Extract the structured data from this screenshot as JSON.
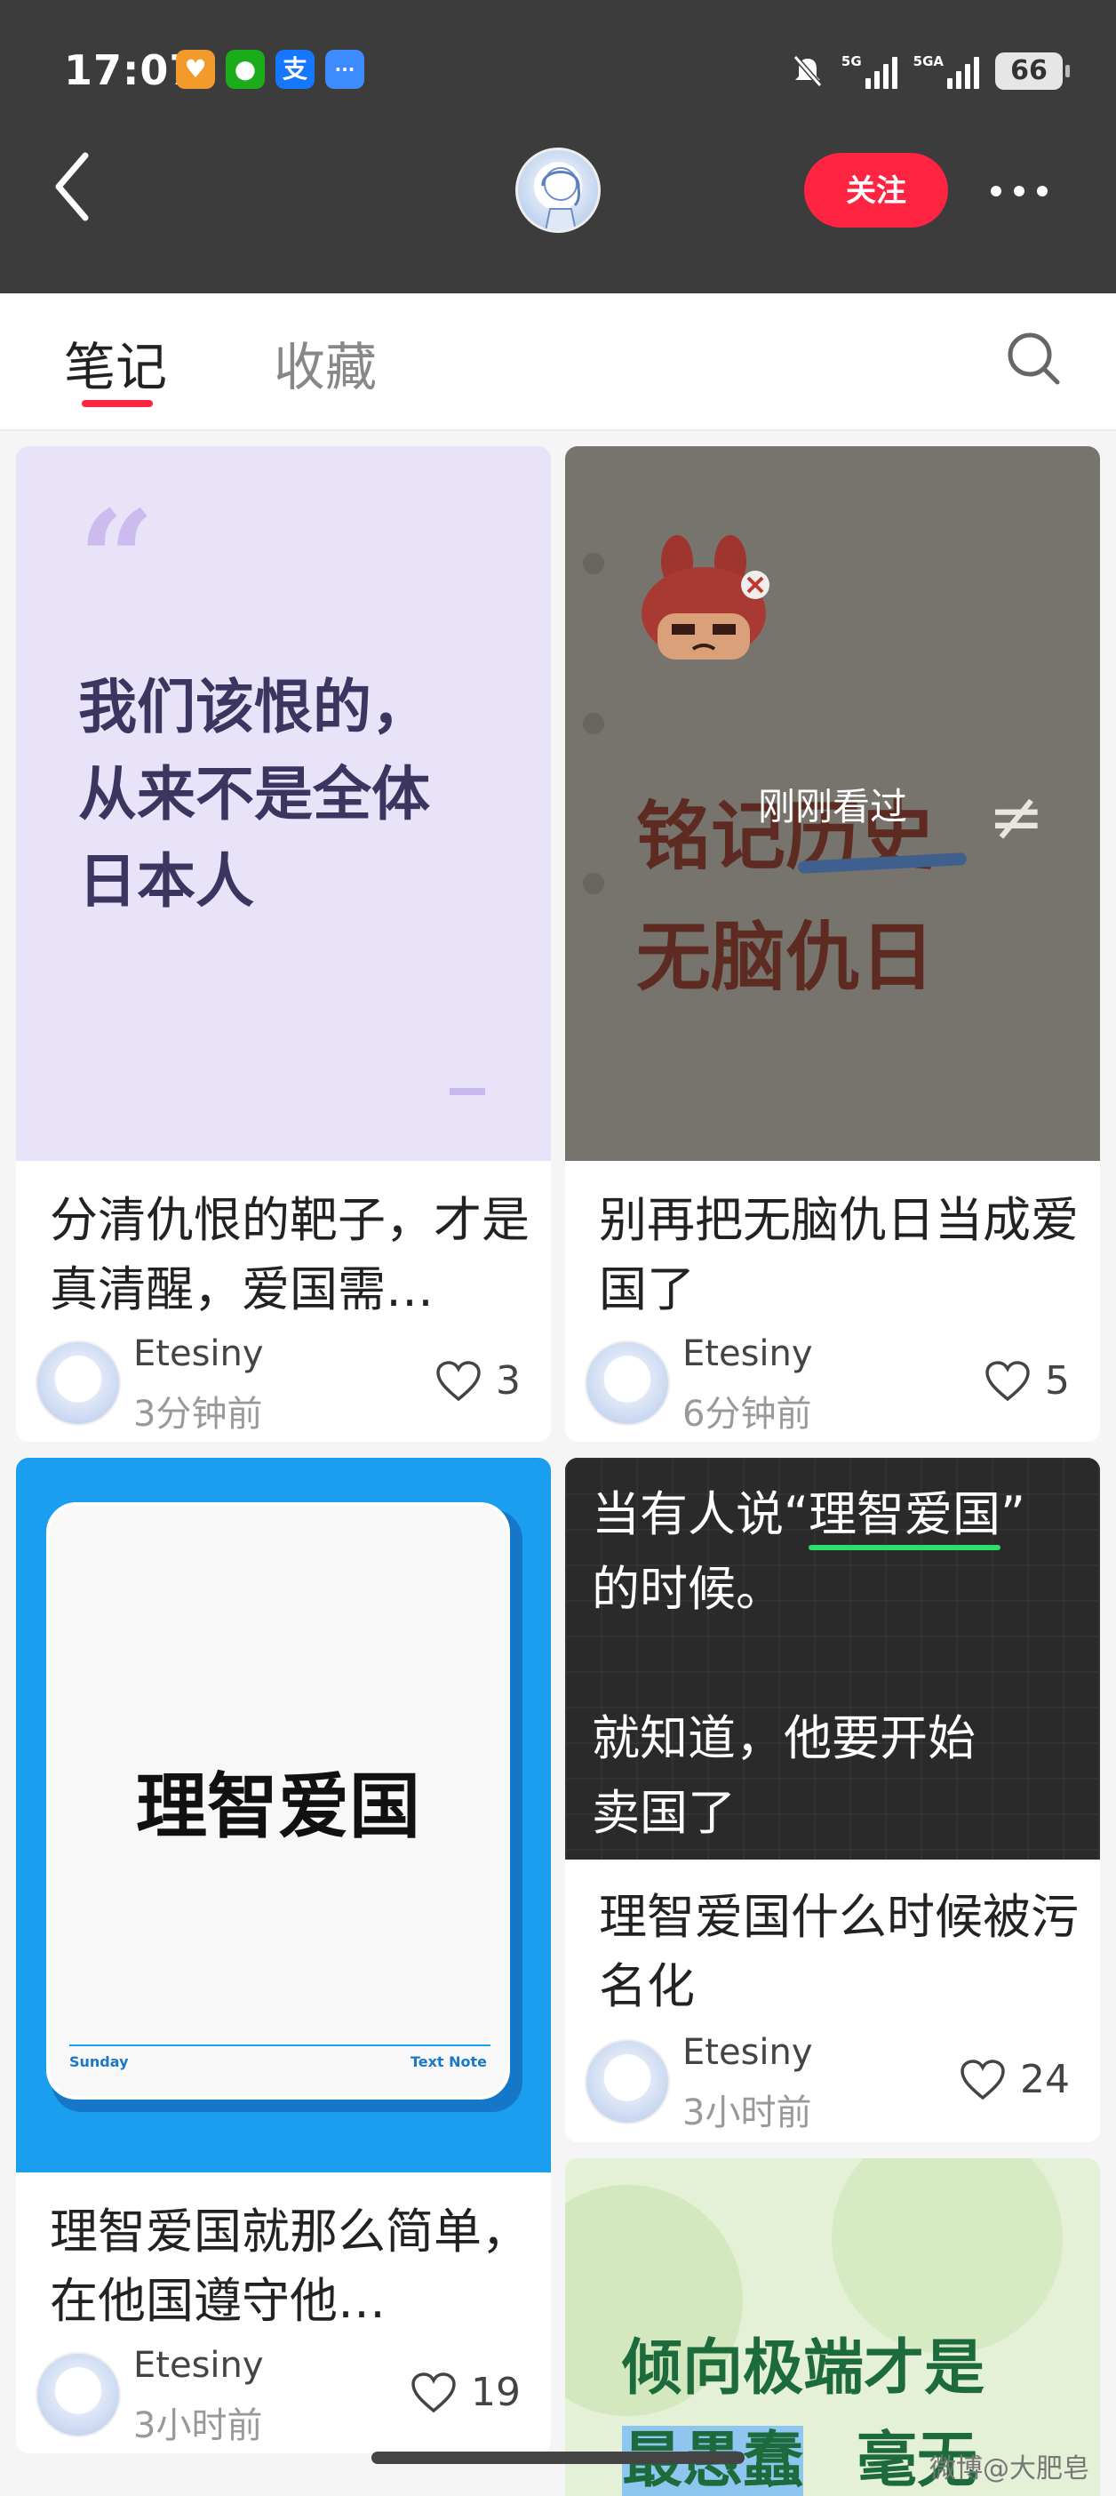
{
  "status_bar": {
    "time": "17:07",
    "network1": "5G",
    "network2": "5GA",
    "battery": "66"
  },
  "app_icons": [
    {
      "name": "heart-app-icon",
      "glyph": "♥",
      "color": "#f39a2c"
    },
    {
      "name": "wechat-icon",
      "glyph": "●",
      "color": "#1aad19"
    },
    {
      "name": "alipay-icon",
      "glyph": "支",
      "color": "#1677ff"
    },
    {
      "name": "message-icon",
      "glyph": "···",
      "color": "#3d8bff"
    }
  ],
  "header": {
    "follow_label": "关注"
  },
  "tabs": [
    {
      "label": "笔记",
      "active": true
    },
    {
      "label": "收藏",
      "active": false
    }
  ],
  "cards": [
    {
      "cover_text": [
        "我们该恨的，",
        "从来不是全体",
        "日本人"
      ],
      "title": "分清仇恨的靶子，才是真清醒，爱国需…",
      "author": "Etesiny",
      "time": "3分钟前",
      "likes": "3"
    },
    {
      "cover_line1": "铭记历史",
      "cover_symbol": "≠",
      "cover_line2": "无脑仇日",
      "overlay": "刚刚看过",
      "title": "别再把无脑仇日当成爱国了",
      "author": "Etesiny",
      "time": "6分钟前",
      "likes": "5"
    },
    {
      "cover_text": "理智爱国",
      "cover_footer_left": "Sunday",
      "cover_footer_right": "Text Note",
      "title": "理智爱国就那么简单，在他国遵守他…",
      "author": "Etesiny",
      "time": "3小时前",
      "likes": "19"
    },
    {
      "cover_line1_a": "当有人说“",
      "cover_line1_b": "理智爱国",
      "cover_line1_c": "”",
      "cover_line2": "的时候。",
      "cover_line3": "就知道，他要开始",
      "cover_line4": "卖国了",
      "title": "理智爱国什么时候被污名化",
      "author": "Etesiny",
      "time": "3小时前",
      "likes": "24"
    },
    {
      "cover_line1": "倾向极端才是",
      "cover_line2_a": "最愚蠢",
      "cover_line2_b": "毫无"
    }
  ],
  "watermark": "微博@大肥皂",
  "colors": {
    "accent": "#ff2442",
    "topbar": "#3c3c3c"
  }
}
